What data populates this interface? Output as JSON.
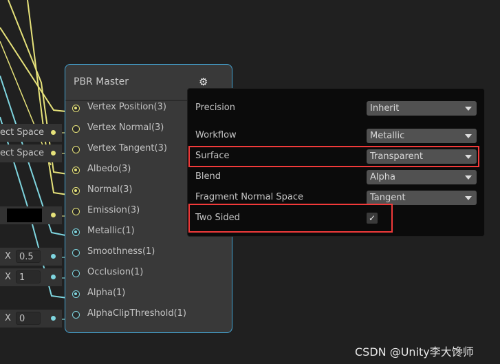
{
  "node": {
    "title": "PBR Master",
    "gear_icon": "gear-icon",
    "ports": [
      {
        "label": "Vertex Position(3)",
        "color": "yellow",
        "connected": true
      },
      {
        "label": "Vertex Normal(3)",
        "color": "yellow",
        "connected": false
      },
      {
        "label": "Vertex Tangent(3)",
        "color": "yellow",
        "connected": false
      },
      {
        "label": "Albedo(3)",
        "color": "yellow",
        "connected": true
      },
      {
        "label": "Normal(3)",
        "color": "yellow",
        "connected": true
      },
      {
        "label": "Emission(3)",
        "color": "yellow",
        "connected": false
      },
      {
        "label": "Metallic(1)",
        "color": "cyan",
        "connected": true
      },
      {
        "label": "Smoothness(1)",
        "color": "cyan",
        "connected": false
      },
      {
        "label": "Occlusion(1)",
        "color": "cyan",
        "connected": false
      },
      {
        "label": "Alpha(1)",
        "color": "cyan",
        "connected": true
      },
      {
        "label": "AlphaClipThreshold(1)",
        "color": "cyan",
        "connected": false
      }
    ]
  },
  "inputs": {
    "vertex_normal": "ect Space",
    "vertex_tangent": "ect Space",
    "emission_color": "#000000",
    "smoothness_axis": "X",
    "smoothness": "0.5",
    "occlusion_axis": "X",
    "occlusion": "1",
    "clip_axis": "X",
    "clip": "0"
  },
  "settings": {
    "precision": {
      "label": "Precision",
      "value": "Inherit"
    },
    "workflow": {
      "label": "Workflow",
      "value": "Metallic"
    },
    "surface": {
      "label": "Surface",
      "value": "Transparent"
    },
    "blend": {
      "label": "Blend",
      "value": "Alpha"
    },
    "fragment_normal_space": {
      "label": "Fragment Normal Space",
      "value": "Tangent"
    },
    "two_sided": {
      "label": "Two Sided",
      "checked": true,
      "mark": "✓"
    }
  },
  "colors": {
    "yellow": "#e6e27a",
    "cyan": "#7fd6e0",
    "highlight": "#f23a3a",
    "node_border": "#44a6d6"
  },
  "watermark": "CSDN @Unity李大馋师"
}
